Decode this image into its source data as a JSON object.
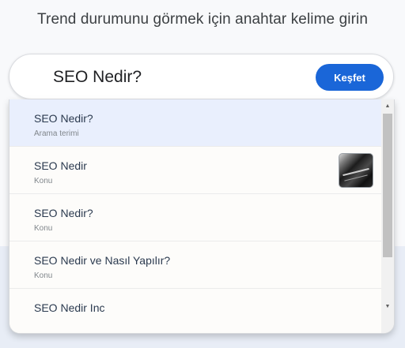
{
  "heading": "Trend durumunu görmek için anahtar kelime girin",
  "search": {
    "value": "SEO Nedir?",
    "button_label": "Keşfet"
  },
  "suggestions": [
    {
      "title": "SEO Nedir?",
      "subtitle": "Arama terimi",
      "selected": true
    },
    {
      "title": "SEO Nedir",
      "subtitle": "Konu",
      "has_thumbnail": true
    },
    {
      "title": "SEO Nedir?",
      "subtitle": "Konu"
    },
    {
      "title": "SEO Nedir ve Nasıl Yapılır?",
      "subtitle": "Konu"
    },
    {
      "title": "SEO Nedir Inc",
      "subtitle": ""
    }
  ],
  "scrollbar": {
    "up_icon": "▲",
    "down_icon": "▼"
  },
  "colors": {
    "accent": "#1a66d8",
    "selected_row": "#e9effd"
  }
}
